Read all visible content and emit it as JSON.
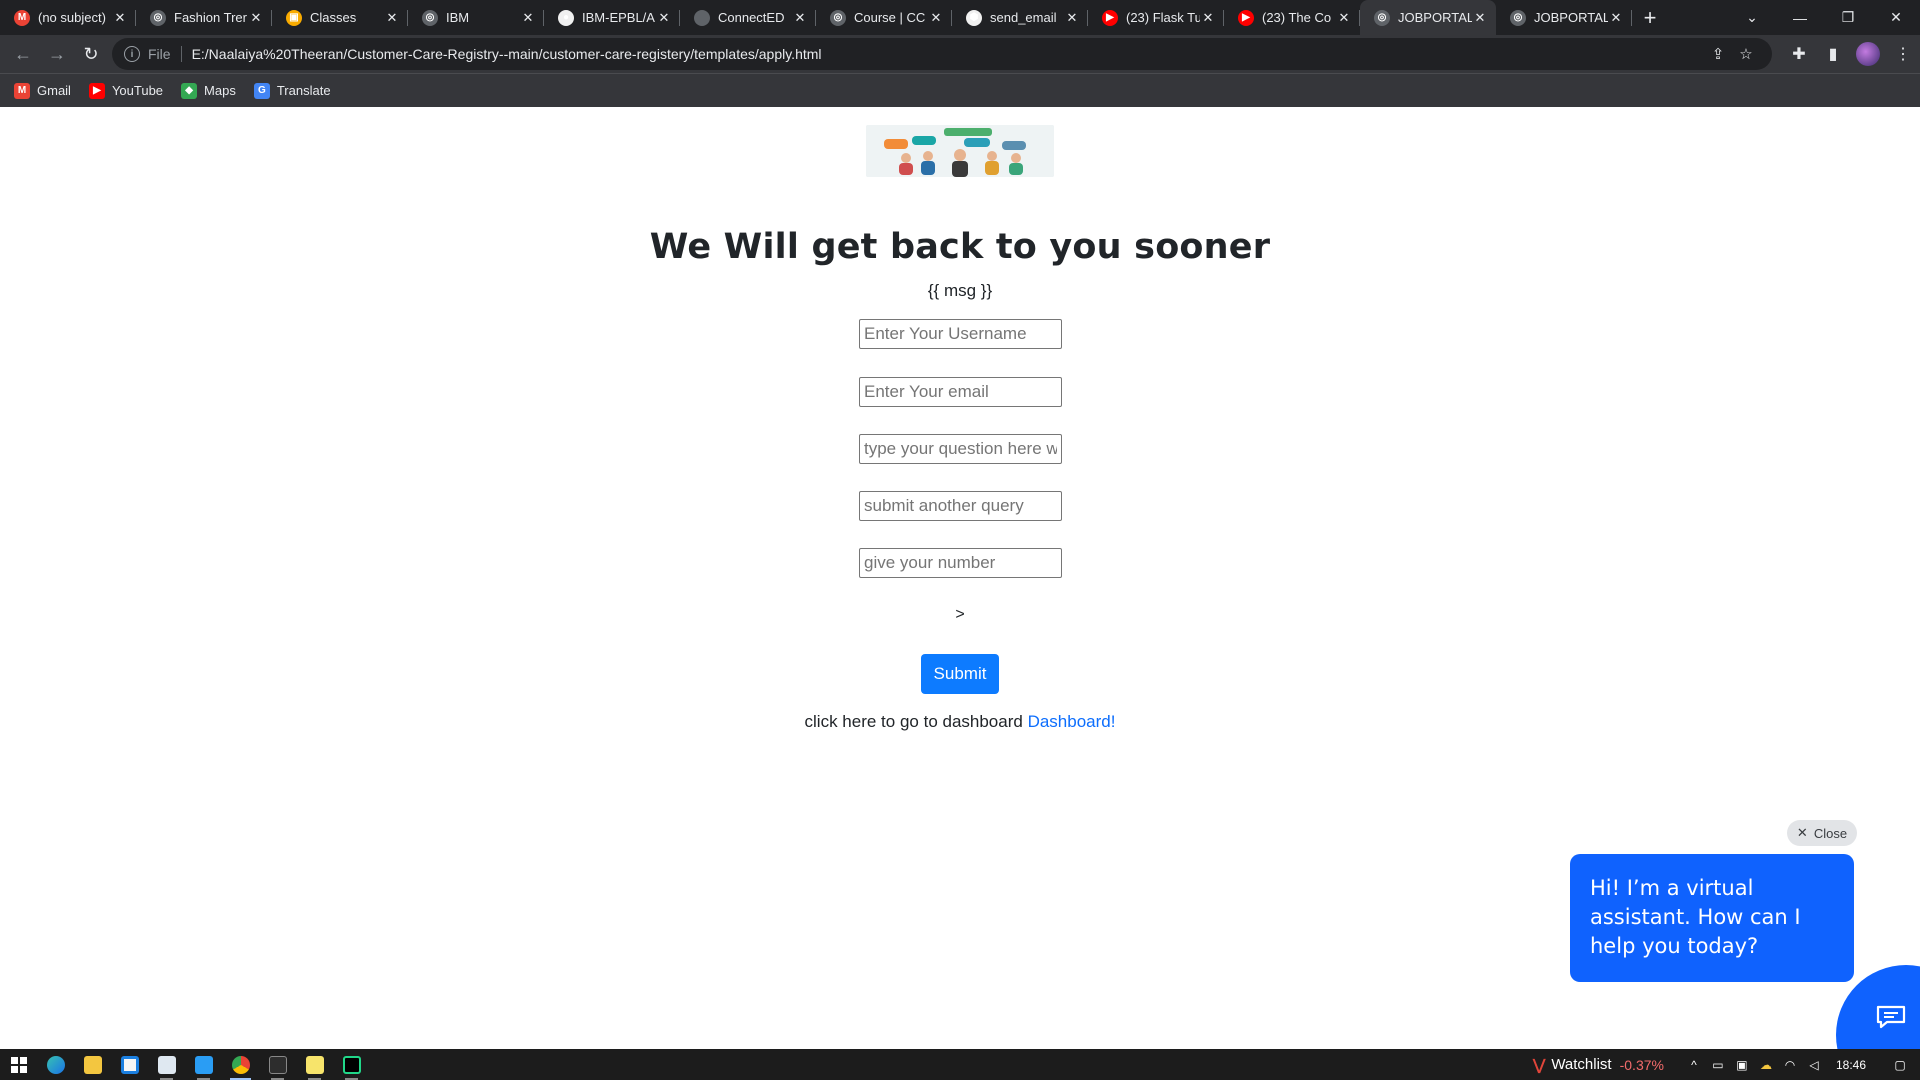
{
  "browser": {
    "tabs": [
      {
        "title": "(no subject)",
        "icon": "gmail-icon",
        "color": "#ea4335",
        "glyph": "M"
      },
      {
        "title": "Fashion Trer",
        "icon": "globe-icon",
        "color": "#5f6368",
        "glyph": "◎"
      },
      {
        "title": "Classes",
        "icon": "classroom-icon",
        "color": "#f9ab00",
        "glyph": "▣"
      },
      {
        "title": "IBM",
        "icon": "globe-icon",
        "color": "#5f6368",
        "glyph": "◎"
      },
      {
        "title": "IBM-EPBL/A",
        "icon": "github-icon",
        "color": "#f0f0f0",
        "glyph": "●"
      },
      {
        "title": "ConnectED",
        "icon": "apple-icon",
        "color": "#5f6368",
        "glyph": ""
      },
      {
        "title": "Course | CC",
        "icon": "globe-icon",
        "color": "#5f6368",
        "glyph": "◎"
      },
      {
        "title": "send_email",
        "icon": "shield-icon",
        "color": "#f0f0f0",
        "glyph": "⬢"
      },
      {
        "title": "(23) Flask Tu",
        "icon": "youtube-icon",
        "color": "#ff0000",
        "glyph": "▶"
      },
      {
        "title": "(23) The Co",
        "icon": "youtube-icon",
        "color": "#ff0000",
        "glyph": "▶"
      },
      {
        "title": "JOBPORTAL",
        "icon": "globe-icon",
        "color": "#5f6368",
        "glyph": "◎",
        "active": true
      },
      {
        "title": "JOBPORTAL",
        "icon": "globe-icon",
        "color": "#5f6368",
        "glyph": "◎"
      }
    ],
    "scheme": "File",
    "url": "E:/Naalaiya%20Theeran/Customer-Care-Registry--main/customer-care-registery/templates/apply.html",
    "bookmarks": [
      {
        "label": "Gmail",
        "icon": "gmail-icon",
        "color": "#ea4335",
        "glyph": "M"
      },
      {
        "label": "YouTube",
        "icon": "youtube-icon",
        "color": "#ff0000",
        "glyph": "▶"
      },
      {
        "label": "Maps",
        "icon": "maps-icon",
        "color": "#34a853",
        "glyph": "◆"
      },
      {
        "label": "Translate",
        "icon": "translate-icon",
        "color": "#4285f4",
        "glyph": "G"
      }
    ]
  },
  "page": {
    "heading": "We Will get back to you sooner",
    "msg": "{{ msg }}",
    "fields": {
      "username_placeholder": "Enter Your Username",
      "email_placeholder": "Enter Your email",
      "question_placeholder": "type your question here w",
      "query_placeholder": "submit another query",
      "number_placeholder": "give your number"
    },
    "stray_text": ">",
    "submit_label": "Submit",
    "dashboard_text": "click here to go to dashboard",
    "dashboard_link": "Dashboard!"
  },
  "assistant": {
    "close_label": "Close",
    "message": "Hi! I’m a virtual assistant. How can I help you today?"
  },
  "taskbar": {
    "watchlist_label": "Watchlist",
    "watchlist_change": "-0.37%",
    "time": "18:46"
  }
}
